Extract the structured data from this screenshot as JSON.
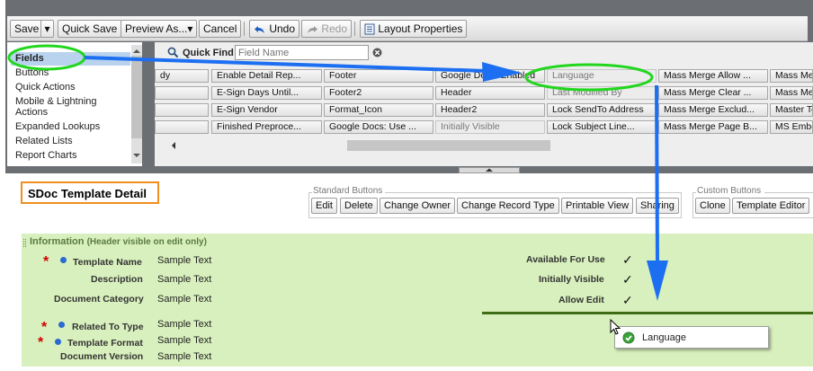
{
  "toolbar": {
    "save": "Save",
    "quick_save": "Quick Save",
    "preview_as": "Preview As...",
    "cancel": "Cancel",
    "undo": "Undo",
    "redo": "Redo",
    "layout_properties": "Layout Properties"
  },
  "palette": {
    "categories": [
      "Fields",
      "Buttons",
      "Quick Actions",
      "Mobile & Lightning",
      "Actions",
      "Expanded Lookups",
      "Related Lists",
      "Report Charts"
    ],
    "selected_category": "Fields",
    "quick_find_label": "Quick Find",
    "quick_find_placeholder": "Field Name",
    "fields": [
      [
        "dy",
        "Enable Detail Rep...",
        "Footer",
        "Google Docs: Enabled",
        "Language",
        "Mass Merge Allow ...",
        "Mass Me"
      ],
      [
        "",
        "E-Sign Days Until...",
        "Footer2",
        "Header",
        "Last Modified By",
        "Mass Merge Clear ...",
        "Mass Me"
      ],
      [
        "",
        "E-Sign Vendor",
        "Format_Icon",
        "Header2",
        "Lock SendTo Address",
        "Mass Merge Exclud...",
        "Master Te"
      ],
      [
        "",
        "Finished Preproce...",
        "Google Docs: Use ...",
        "Initially Visible",
        "Lock Subject Line...",
        "Mass Merge Page B...",
        "MS Embe"
      ]
    ]
  },
  "layout": {
    "title": "SDoc Template Detail",
    "standard_buttons_label": "Standard Buttons",
    "standard_buttons": [
      "Edit",
      "Delete",
      "Change Owner",
      "Change Record Type",
      "Printable View",
      "Sharing"
    ],
    "custom_buttons_label": "Custom Buttons",
    "custom_buttons": [
      "Clone",
      "Template Editor"
    ],
    "section": {
      "title": "Information",
      "hint": "(Header visible on edit only)",
      "left_fields": [
        {
          "label": "Template Name",
          "value": "Sample Text",
          "required": true
        },
        {
          "label": "Description",
          "value": "Sample Text",
          "required": false
        },
        {
          "label": "Document Category",
          "value": "Sample Text",
          "required": false
        },
        {
          "label": "Related To Type",
          "value": "Sample Text",
          "required": true
        },
        {
          "label": "Template Format",
          "value": "Sample Text",
          "required": true
        },
        {
          "label": "Document Version",
          "value": "Sample Text",
          "required": false
        }
      ],
      "right_fields": [
        {
          "label": "Available For Use",
          "value": "✓"
        },
        {
          "label": "Initially Visible",
          "value": "✓"
        },
        {
          "label": "Allow Edit",
          "value": "✓"
        }
      ]
    },
    "drag_item": "Language"
  },
  "colors": {
    "highlight_green": "#22d61e",
    "arrow_blue": "#1d6ff2",
    "title_box_orange": "#f08e1e",
    "section_green": "#d8f0bd",
    "drop_line": "#3f6d16"
  }
}
